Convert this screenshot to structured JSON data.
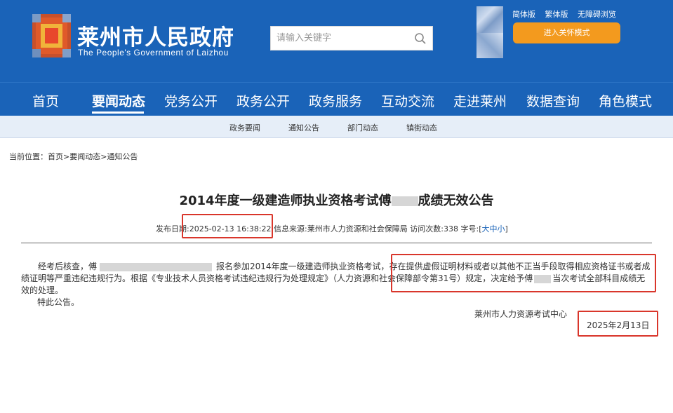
{
  "header": {
    "title": "莱州市人民政府",
    "subtitle": "The People's Government of Laizhou",
    "search_placeholder": "请输入关键字",
    "top_links": [
      "简体版",
      "繁体版",
      "无障碍浏览"
    ],
    "care_mode_label": "进入关怀模式"
  },
  "nav": {
    "items": [
      "首页",
      "要闻动态",
      "党务公开",
      "政务公开",
      "政务服务",
      "互动交流",
      "走进莱州",
      "数据查询",
      "角色模式"
    ],
    "active": "要闻动态"
  },
  "subnav": {
    "items": [
      "政务要闻",
      "通知公告",
      "部门动态",
      "镇街动态"
    ]
  },
  "breadcrumb": "当前位置：首页>要闻动态>通知公告",
  "article": {
    "title_prefix": "2014年度一级建造师执业资格考试傅",
    "title_suffix": "成绩无效公告",
    "meta": {
      "date_label": "发布日期:",
      "date_value": "2025-02-13 16:38:22",
      "source_label": "信息来源:",
      "source_value": "莱州市人力资源和社会保障局",
      "visits_label": "访问次数:",
      "visits_value": "338",
      "font_label": "字号:",
      "font_open": "[",
      "font_sizes": "大中小",
      "font_close": "]"
    },
    "para1_a": "经考后核查，傅",
    "para1_b": "报名参加2014年度一级建造师执业资格考试，存在提供虚假证明材料或者以其他不正当手段取得相应资格证书或者成绩证明等严重违纪违规行为。根据《专业技术人员资格考试违纪违规行为处理规定》（人力资源和社会保障部令第31号）规定，决定给予傅",
    "para1_c": "当次考试全部科目成绩无效的处理。",
    "closing": "特此公告。",
    "signer": "莱州市人力资源考试中心",
    "sign_date": "2025年2月13日"
  }
}
